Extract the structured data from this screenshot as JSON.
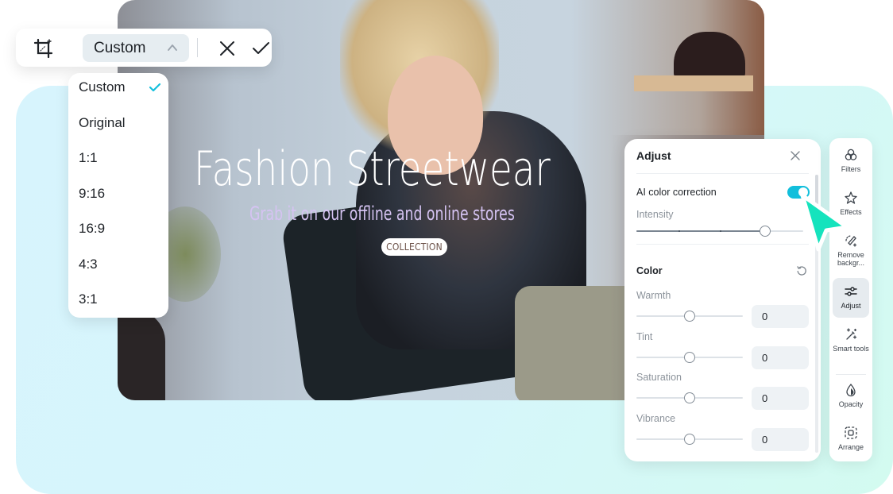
{
  "canvas": {
    "headline": "Fashion Streetwear",
    "subline": "Grab it on our offline and online stores",
    "collection_button": "COLLECTION"
  },
  "crop_toolbar": {
    "crop_icon": "crop-icon",
    "ratio_selected": "Custom",
    "ratio_chevron_icon": "chevron-up-icon",
    "cancel_icon": "close-icon",
    "confirm_icon": "check-icon"
  },
  "ratio_menu": {
    "items": [
      {
        "label": "Custom",
        "selected": true
      },
      {
        "label": "Original",
        "selected": false
      },
      {
        "label": "1:1",
        "selected": false
      },
      {
        "label": "9:16",
        "selected": false
      },
      {
        "label": "16:9",
        "selected": false
      },
      {
        "label": "4:3",
        "selected": false
      },
      {
        "label": "3:1",
        "selected": false
      }
    ],
    "check_color": "#12bfdc"
  },
  "adjust_panel": {
    "title": "Adjust",
    "ai_color_correction": {
      "label": "AI color correction",
      "enabled": true,
      "intensity_label": "Intensity",
      "intensity_fraction": 0.77
    },
    "color_section": {
      "title": "Color",
      "reset_icon": "reset-icon",
      "sliders": [
        {
          "label": "Warmth",
          "value": "0",
          "fraction": 0.5
        },
        {
          "label": "Tint",
          "value": "0",
          "fraction": 0.5
        },
        {
          "label": "Saturation",
          "value": "0",
          "fraction": 0.5
        },
        {
          "label": "Vibrance",
          "value": "0",
          "fraction": 0.5
        }
      ]
    }
  },
  "tool_rail": {
    "items": [
      {
        "label": "Filters",
        "icon": "filters-icon",
        "active": false
      },
      {
        "label": "Effects",
        "icon": "effects-icon",
        "active": false
      },
      {
        "label": "Remove backgr...",
        "icon": "remove-background-icon",
        "active": false
      },
      {
        "label": "Adjust",
        "icon": "adjust-icon",
        "active": true
      },
      {
        "label": "Smart tools",
        "icon": "smart-tools-icon",
        "active": false
      },
      {
        "label": "Opacity",
        "icon": "opacity-icon",
        "active": false
      },
      {
        "label": "Arrange",
        "icon": "arrange-icon",
        "active": false
      }
    ]
  },
  "colors": {
    "accent": "#12bfdc",
    "cursor": "#15e3bd",
    "background_gradient_start": "#d7f4fd",
    "background_gradient_end": "#d3fbf0"
  }
}
